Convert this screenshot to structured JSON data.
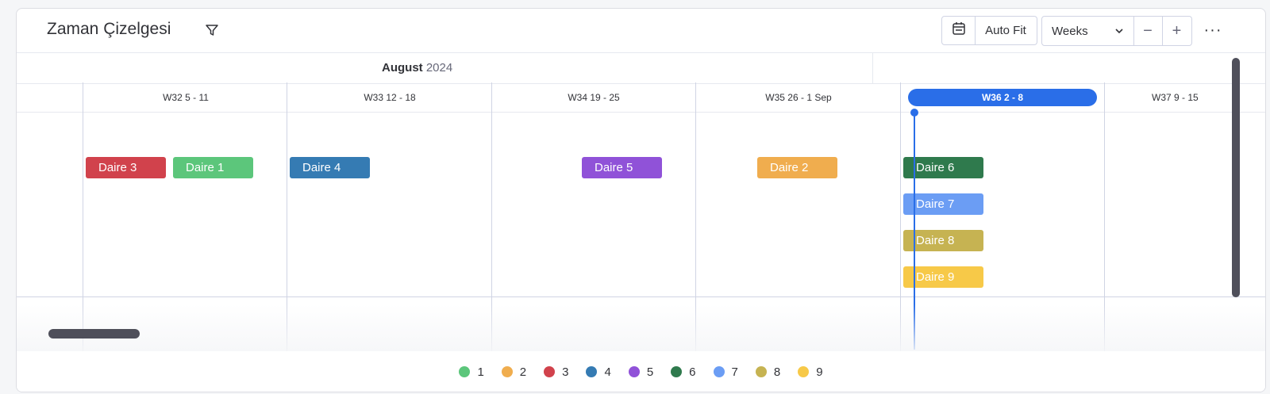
{
  "header": {
    "title": "Zaman Çizelgesi",
    "auto_fit_label": "Auto Fit",
    "scale_select": "Weeks",
    "zoom_out": "−",
    "zoom_in": "+",
    "more": "···"
  },
  "timeline": {
    "month": "August",
    "year": "2024",
    "weeks": [
      "W32 5 - 11",
      "W33 12 - 18",
      "W34 19 - 25",
      "W35 26 - 1 Sep",
      "W36 2 - 8",
      "W37 9 - 15"
    ],
    "current_week": "W36 2 - 8"
  },
  "bars": [
    {
      "label": "Daire 3",
      "color": "#d1424c"
    },
    {
      "label": "Daire 1",
      "color": "#5cc67b"
    },
    {
      "label": "Daire 4",
      "color": "#357bb3"
    },
    {
      "label": "Daire 5",
      "color": "#9052d8"
    },
    {
      "label": "Daire 2",
      "color": "#f0ad4e"
    },
    {
      "label": "Daire 6",
      "color": "#2f7a4d"
    },
    {
      "label": "Daire 7",
      "color": "#6b9df4"
    },
    {
      "label": "Daire 8",
      "color": "#c6b352"
    },
    {
      "label": "Daire 9",
      "color": "#f7c948"
    }
  ],
  "legend": [
    {
      "label": "1",
      "color": "#5cc67b"
    },
    {
      "label": "2",
      "color": "#f0ad4e"
    },
    {
      "label": "3",
      "color": "#d1424c"
    },
    {
      "label": "4",
      "color": "#357bb3"
    },
    {
      "label": "5",
      "color": "#9052d8"
    },
    {
      "label": "6",
      "color": "#2f7a4d"
    },
    {
      "label": "7",
      "color": "#6b9df4"
    },
    {
      "label": "8",
      "color": "#c6b352"
    },
    {
      "label": "9",
      "color": "#f7c948"
    }
  ]
}
